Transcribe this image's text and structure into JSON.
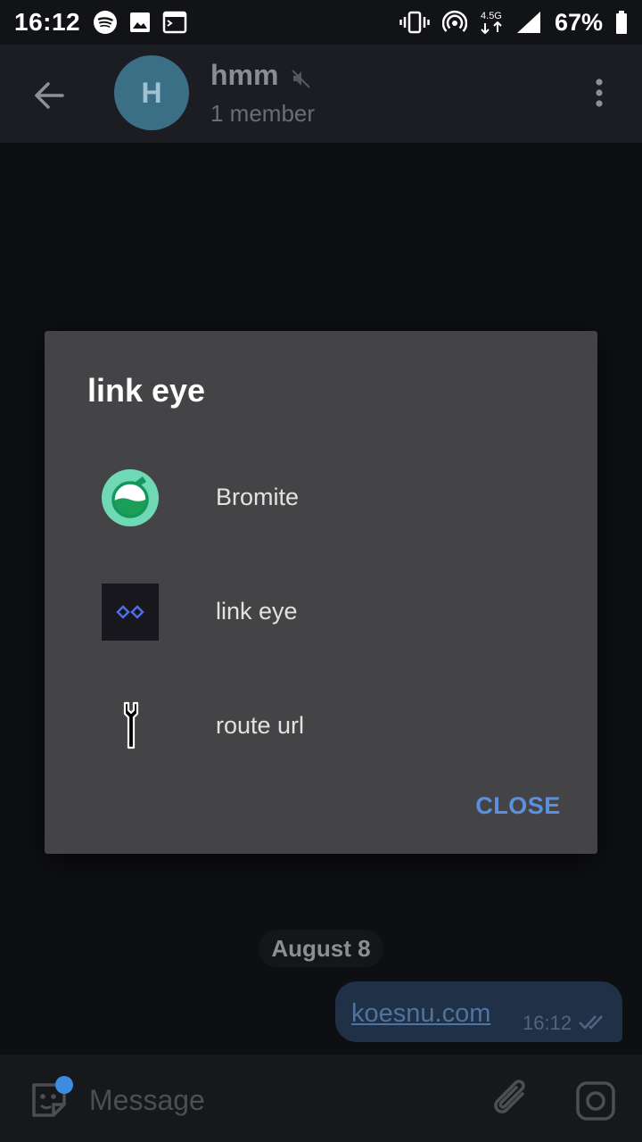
{
  "status_bar": {
    "time": "16:12",
    "network_label": "4.5G",
    "battery": "67%",
    "icons": [
      "spotify-icon",
      "image-icon",
      "terminal-icon",
      "vibrate-icon",
      "hotspot-icon",
      "network-icon",
      "signal-icon",
      "battery-icon"
    ]
  },
  "header": {
    "avatar_letter": "H",
    "title": "hmm",
    "subtitle": "1 member"
  },
  "chat": {
    "date": "August 8",
    "message": {
      "text": "koesnu.com",
      "time": "16:12"
    }
  },
  "input_bar": {
    "placeholder": "Message"
  },
  "dialog": {
    "title": "link eye",
    "options": [
      {
        "label": "Bromite",
        "icon": "bromite-icon"
      },
      {
        "label": "link eye",
        "icon": "link-eye-icon"
      },
      {
        "label": "route url",
        "icon": "route-url-icon"
      }
    ],
    "close_label": "CLOSE"
  },
  "colors": {
    "accent": "#5b8fe0",
    "dialog_bg": "#444446",
    "bubble_bg": "#1f3047",
    "avatar_bg": "#3a6f86"
  }
}
